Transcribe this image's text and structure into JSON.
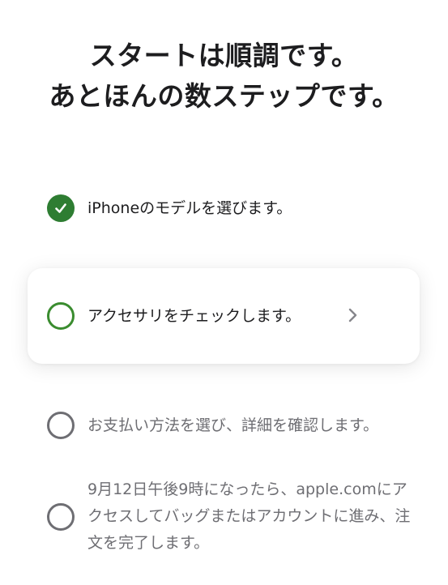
{
  "header": {
    "title_line1": "スタートは順調です。",
    "title_line2": "あとほんの数ステップです。"
  },
  "steps": [
    {
      "label": "iPhoneのモデルを選びます。",
      "status": "done",
      "icon": "checkmark-icon"
    },
    {
      "label": "アクセサリをチェックします。",
      "status": "current",
      "icon": "chevron-right-icon"
    },
    {
      "label": "お支払い方法を選び、詳細を確認します。",
      "status": "pending"
    },
    {
      "label": "9月12日午後9時になったら、apple.comにアクセスしてバッグまたはアカウントに進み、注文を完了します。",
      "status": "pending"
    }
  ],
  "colors": {
    "done": "#2e7d32",
    "current": "#3a8c2f",
    "pending": "#6e6e73",
    "text": "#1d1d1f"
  }
}
